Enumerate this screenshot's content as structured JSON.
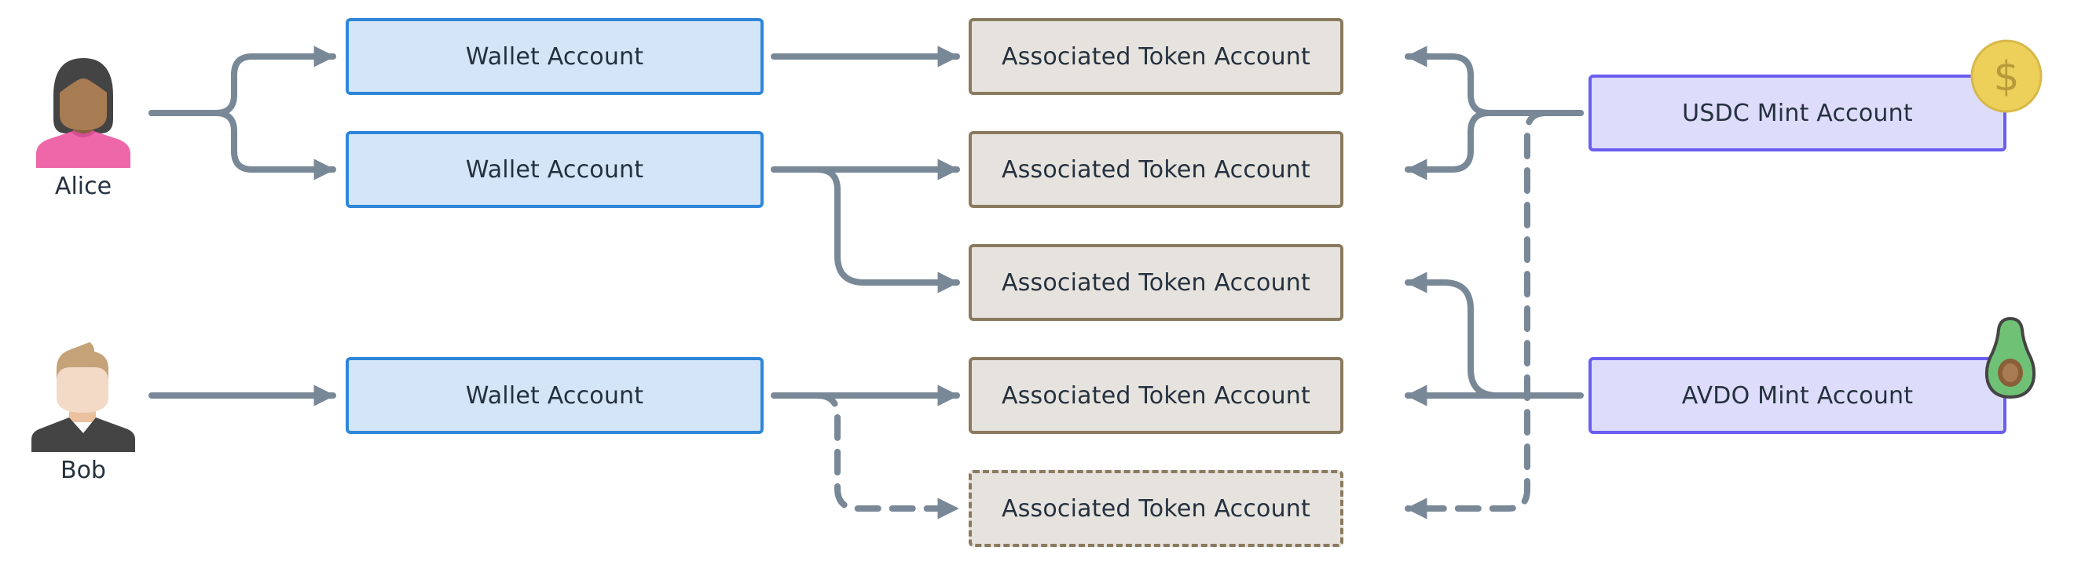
{
  "diagram": {
    "colors": {
      "connector": "#798897",
      "wallet_fill": "#d3e5f6",
      "wallet_border": "#2f86d8",
      "ata_fill": "#e6e3de",
      "ata_border": "#8a7a5e",
      "mint_fill": "#dedcfb",
      "mint_border": "#6a5ef0",
      "text": "#25313f"
    },
    "people": [
      {
        "id": "alice",
        "label": "Alice",
        "icon": "woman-avatar-icon"
      },
      {
        "id": "bob",
        "label": "Bob",
        "icon": "man-avatar-icon"
      }
    ],
    "wallets": [
      {
        "id": "w1",
        "label": "Wallet Account",
        "owner": "alice"
      },
      {
        "id": "w2",
        "label": "Wallet Account",
        "owner": "alice"
      },
      {
        "id": "w3",
        "label": "Wallet Account",
        "owner": "bob"
      }
    ],
    "atas": [
      {
        "id": "a1",
        "label": "Associated Token Account",
        "style": "solid"
      },
      {
        "id": "a2",
        "label": "Associated Token Account",
        "style": "solid"
      },
      {
        "id": "a3",
        "label": "Associated Token Account",
        "style": "solid"
      },
      {
        "id": "a4",
        "label": "Associated Token Account",
        "style": "solid"
      },
      {
        "id": "a5",
        "label": "Associated Token Account",
        "style": "dashed"
      }
    ],
    "mints": [
      {
        "id": "usdc",
        "label": "USDC Mint Account",
        "icon": "dollar-coin-icon",
        "icon_glyph": "$"
      },
      {
        "id": "avdo",
        "label": "AVDO Mint Account",
        "icon": "avocado-icon"
      }
    ],
    "edges": [
      {
        "from": "alice",
        "to": "w1",
        "style": "solid"
      },
      {
        "from": "alice",
        "to": "w2",
        "style": "solid"
      },
      {
        "from": "bob",
        "to": "w3",
        "style": "solid"
      },
      {
        "from": "w1",
        "to": "a1",
        "style": "solid"
      },
      {
        "from": "w2",
        "to": "a2",
        "style": "solid"
      },
      {
        "from": "w2",
        "to": "a3",
        "style": "solid"
      },
      {
        "from": "w3",
        "to": "a4",
        "style": "solid"
      },
      {
        "from": "w3",
        "to": "a5",
        "style": "dashed"
      },
      {
        "from": "usdc",
        "to": "a1",
        "style": "solid"
      },
      {
        "from": "usdc",
        "to": "a2",
        "style": "solid"
      },
      {
        "from": "usdc",
        "to": "a5",
        "style": "dashed"
      },
      {
        "from": "avdo",
        "to": "a3",
        "style": "solid"
      },
      {
        "from": "avdo",
        "to": "a4",
        "style": "solid"
      }
    ]
  }
}
